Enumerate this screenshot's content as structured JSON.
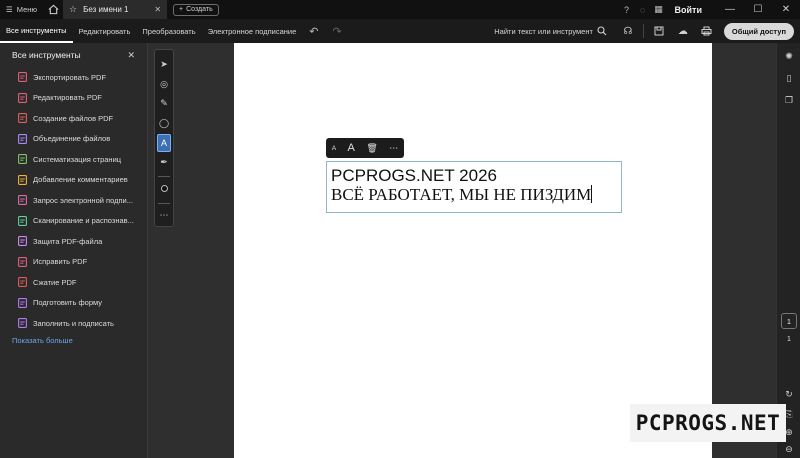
{
  "titlebar": {
    "menu_label": "Меню",
    "tab_title": "Без имени 1",
    "create_label": "Создать",
    "login_label": "Войти"
  },
  "toolbar": {
    "items": [
      {
        "label": "Все инструменты",
        "active": true
      },
      {
        "label": "Редактировать"
      },
      {
        "label": "Преобразовать"
      },
      {
        "label": "Электронное подписание"
      }
    ],
    "find_label": "Найти текст или инструмент",
    "share_label": "Общий доступ"
  },
  "left_panel": {
    "title": "Все инструменты",
    "items": [
      {
        "label": "Экспортировать PDF",
        "icon": "export-pdf-icon",
        "color": "#e0607e"
      },
      {
        "label": "Редактировать PDF",
        "icon": "edit-pdf-icon",
        "color": "#e0607e"
      },
      {
        "label": "Создание файлов PDF",
        "icon": "create-pdf-icon",
        "color": "#e06060"
      },
      {
        "label": "Объединение файлов",
        "icon": "combine-files-icon",
        "color": "#a78bfa"
      },
      {
        "label": "Систематизация страниц",
        "icon": "organize-pages-icon",
        "color": "#7fc36b"
      },
      {
        "label": "Добавление комментариев",
        "icon": "comment-icon",
        "color": "#f0b03a"
      },
      {
        "label": "Запрос электронной подпи...",
        "icon": "request-sign-icon",
        "color": "#e06aa8"
      },
      {
        "label": "Сканирование и распознав...",
        "icon": "scan-icon",
        "color": "#5fd0a0"
      },
      {
        "label": "Защита PDF-файла",
        "icon": "protect-icon",
        "color": "#c88cf0"
      },
      {
        "label": "Исправить PDF",
        "icon": "redact-icon",
        "color": "#e06080"
      },
      {
        "label": "Сжатие PDF",
        "icon": "compress-icon",
        "color": "#e05a5a"
      },
      {
        "label": "Подготовить форму",
        "icon": "form-icon",
        "color": "#b07cf0"
      },
      {
        "label": "Заполнить и подписать",
        "icon": "fill-sign-icon",
        "color": "#b07cf0"
      }
    ],
    "more_label": "Показать больше"
  },
  "document": {
    "line1": "PCPROGS.NET 2026",
    "line2": "ВСЁ РАБОТАЕТ, МЫ НЕ ПИЗДИМ",
    "format_small": "A",
    "format_large": "A"
  },
  "pagination": {
    "current": "1",
    "total": "1"
  },
  "watermark": "PCPROGS.NET",
  "colors": {
    "accent": "#3d6fb3",
    "link": "#6aa6f0"
  }
}
